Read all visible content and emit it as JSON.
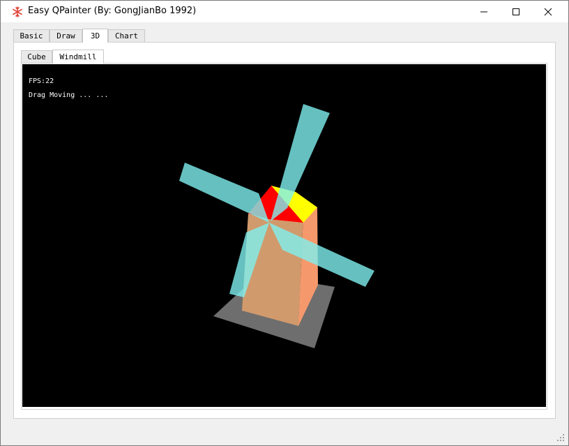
{
  "window": {
    "title": "Easy QPainter (By: GongJianBo 1992)"
  },
  "tabs": [
    {
      "label": "Basic"
    },
    {
      "label": "Draw"
    },
    {
      "label": "3D"
    },
    {
      "label": "Chart"
    }
  ],
  "active_tab": "3D",
  "subtabs": [
    {
      "label": "Cube"
    },
    {
      "label": "Windmill"
    }
  ],
  "active_subtab": "Windmill",
  "scene": {
    "fps_text": "FPS:22",
    "status_text": "Drag Moving ... ...",
    "colors": {
      "background": "#000000",
      "ground": "#6e6e6e",
      "tower_front": "#d19a6c",
      "tower_side": "#f5996c",
      "roof_red": "#ff0000",
      "roof_yellow": "#ffff00",
      "blade": "#7ff0f0"
    }
  },
  "icons": {
    "app": "snowflake-icon",
    "minimize": "minimize-icon",
    "maximize": "maximize-icon",
    "close": "close-icon",
    "resize": "resize-grip-icon"
  }
}
